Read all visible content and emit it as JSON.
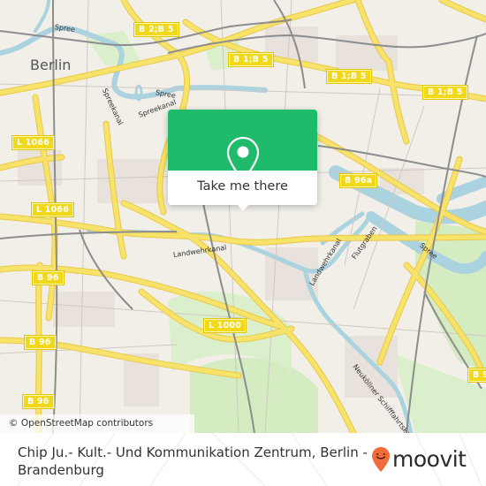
{
  "map": {
    "city_label": "Berlin",
    "attribution": "© OpenStreetMap contributors",
    "road_shields": [
      {
        "id": "b2b5",
        "label": "B 2;B 5"
      },
      {
        "id": "b1b5-a",
        "label": "B 1;B 5"
      },
      {
        "id": "b1b5-b",
        "label": "B 1;B 5"
      },
      {
        "id": "b1b5-c",
        "label": "B 1;B 5"
      },
      {
        "id": "l1066-a",
        "label": "L 1066"
      },
      {
        "id": "l1066-b",
        "label": "L 1066"
      },
      {
        "id": "b96a",
        "label": "B 96a"
      },
      {
        "id": "b96-a",
        "label": "B 96"
      },
      {
        "id": "b96-b",
        "label": "B 96"
      },
      {
        "id": "b96-c",
        "label": "B 96"
      },
      {
        "id": "b96-d",
        "label": "B 9"
      },
      {
        "id": "l1000",
        "label": "L 1000"
      }
    ],
    "water_labels": {
      "spree_nw": "Spree",
      "spreekanal_a": "Spreekanal",
      "spreekanal_b": "Spreekanal",
      "spree_center": "Spree",
      "landwehrkanal_w": "Landwehrkanal",
      "landwehrkanal_e": "Landwehrkanal",
      "flutgraben": "Flutgraben",
      "spree_e": "Spree",
      "neukollner": "Neuköllner Schifffahrtskanal"
    },
    "colors": {
      "land": "#f2efe9",
      "water": "#aad3df",
      "park": "#c8e6b0",
      "road_major": "#f7e36a",
      "rail": "#8a8a8a",
      "shield": "#f1d819"
    }
  },
  "popup": {
    "action_label": "Take me there",
    "accent_color": "#1fbb6a"
  },
  "footer": {
    "place_name": "Chip Ju.- Kult.- Und Kommunikation Zentrum, Berlin - Brandenburg",
    "brand": "moovit",
    "brand_color": "#f26b3a"
  }
}
